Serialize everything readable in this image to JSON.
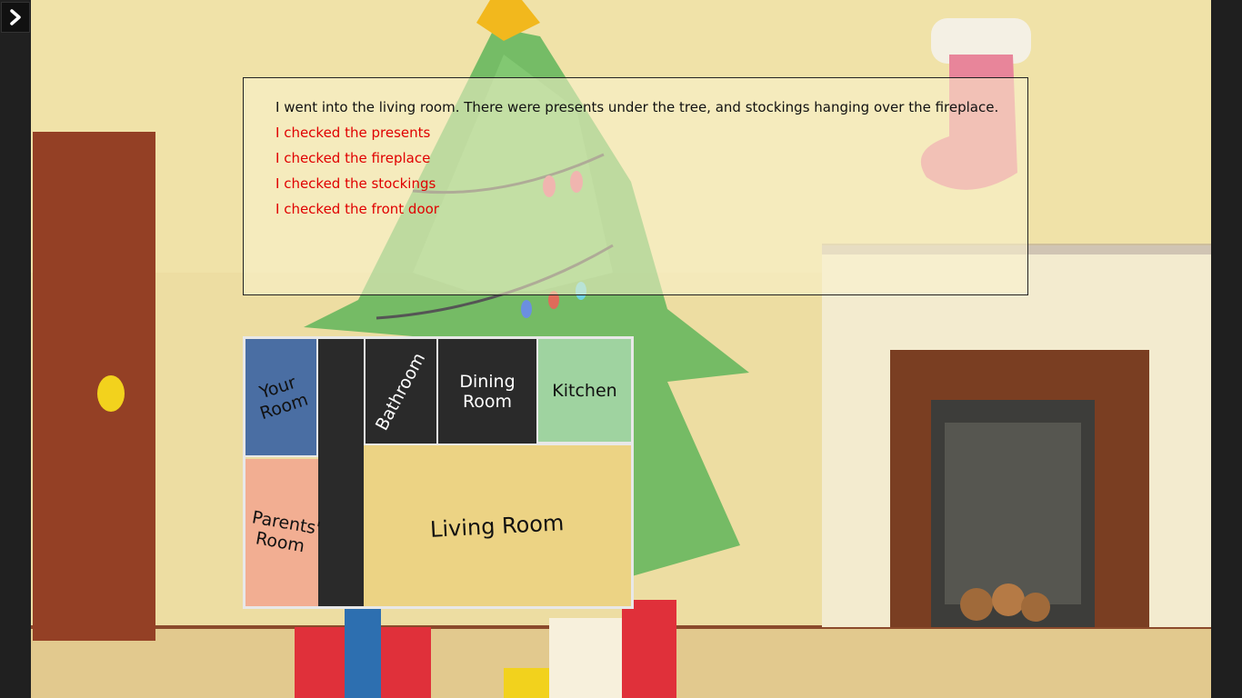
{
  "sidebar": {
    "toggle_icon": "chevron-right-icon"
  },
  "story": {
    "narration": "I went into the living room. There were presents under the tree, and stockings hanging over the fireplace.",
    "choices": [
      "I checked the presents",
      "I checked the fireplace",
      "I checked the stockings",
      "I checked the front door"
    ]
  },
  "map": {
    "rooms": {
      "your_room": "Your Room",
      "bathroom": "Bathroom",
      "dining_room": "Dining Room",
      "kitchen": "Kitchen",
      "parents_room": "Parents' Room",
      "living_room": "Living Room"
    },
    "colors": {
      "your_room": "#4a6ea3",
      "kitchen": "#9fd3a0",
      "parents_room": "#f2ae92",
      "living_room": "#ecd384",
      "hall": "#2a2a2a",
      "wall": "#e8e8e8"
    }
  },
  "colors": {
    "choice_text": "#e00000",
    "narration_text": "#111111"
  }
}
